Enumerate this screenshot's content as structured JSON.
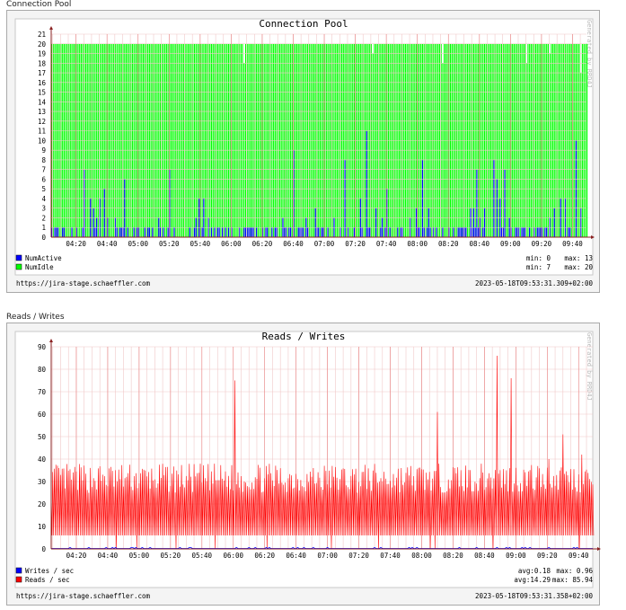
{
  "sections": [
    {
      "heading": "Connection Pool",
      "chart_data": {
        "type": "bar",
        "title": "Connection Pool",
        "watermark": "Generated by RRD4J",
        "ylim": [
          0,
          21
        ],
        "y_ticks": [
          0,
          1,
          2,
          3,
          4,
          5,
          6,
          7,
          8,
          9,
          10,
          11,
          12,
          13,
          14,
          15,
          16,
          17,
          18,
          19,
          20,
          21
        ],
        "x_ticks": [
          "04:20",
          "04:40",
          "05:00",
          "05:20",
          "05:40",
          "06:00",
          "06:20",
          "06:40",
          "07:00",
          "07:20",
          "07:40",
          "08:00",
          "08:20",
          "08:40",
          "09:00",
          "09:20",
          "09:40"
        ],
        "x_range": [
          "04:04",
          "09:49"
        ],
        "grid": true,
        "legend_position": "bottom-left",
        "series": [
          {
            "name": "NumActive",
            "color": "#0000ff",
            "min": "0",
            "max": "13",
            "min_label": "min:  0",
            "max_label": "max:  13",
            "spikes": [
              [
                "04:08",
                1
              ],
              [
                "04:11",
                1
              ],
              [
                "04:17",
                1
              ],
              [
                "04:25",
                7
              ],
              [
                "04:29",
                4
              ],
              [
                "04:31",
                3
              ],
              [
                "04:33",
                2
              ],
              [
                "04:35",
                4
              ],
              [
                "04:38",
                5
              ],
              [
                "04:40",
                2
              ],
              [
                "04:45",
                2
              ],
              [
                "04:51",
                6
              ],
              [
                "04:57",
                1
              ],
              [
                "05:07",
                1
              ],
              [
                "05:13",
                2
              ],
              [
                "05:20",
                7
              ],
              [
                "05:33",
                1
              ],
              [
                "05:37",
                2
              ],
              [
                "05:39",
                4
              ],
              [
                "05:42",
                4
              ],
              [
                "05:45",
                2
              ],
              [
                "05:58",
                1
              ],
              [
                "06:05",
                1
              ],
              [
                "06:11",
                1
              ],
              [
                "06:14",
                1
              ],
              [
                "06:22",
                1
              ],
              [
                "06:28",
                1
              ],
              [
                "06:33",
                2
              ],
              [
                "06:35",
                1
              ],
              [
                "06:37",
                1
              ],
              [
                "06:40",
                9
              ],
              [
                "06:44",
                1
              ],
              [
                "06:48",
                2
              ],
              [
                "06:54",
                3
              ],
              [
                "06:58",
                1
              ],
              [
                "07:06",
                2
              ],
              [
                "07:13",
                8
              ],
              [
                "07:19",
                1
              ],
              [
                "07:23",
                4
              ],
              [
                "07:27",
                11
              ],
              [
                "07:33",
                3
              ],
              [
                "07:37",
                2
              ],
              [
                "07:40",
                5
              ],
              [
                "07:42",
                1
              ],
              [
                "07:49",
                1
              ],
              [
                "07:55",
                2
              ],
              [
                "07:59",
                3
              ],
              [
                "08:03",
                8
              ],
              [
                "08:07",
                3
              ],
              [
                "08:10",
                1
              ],
              [
                "08:16",
                1
              ],
              [
                "08:23",
                1
              ],
              [
                "08:34",
                3
              ],
              [
                "08:36",
                3
              ],
              [
                "08:38",
                7
              ],
              [
                "08:40",
                2
              ],
              [
                "08:43",
                3
              ],
              [
                "08:49",
                8
              ],
              [
                "08:51",
                6
              ],
              [
                "08:53",
                4
              ],
              [
                "08:56",
                7
              ],
              [
                "08:59",
                2
              ],
              [
                "09:04",
                1
              ],
              [
                "09:12",
                1
              ],
              [
                "09:20",
                1
              ],
              [
                "09:25",
                2
              ],
              [
                "09:28",
                3
              ],
              [
                "09:32",
                4
              ],
              [
                "09:35",
                4
              ],
              [
                "09:38",
                1
              ],
              [
                "09:42",
                10
              ],
              [
                "09:45",
                3
              ]
            ]
          },
          {
            "name": "NumIdle",
            "color": "#00ff00",
            "min": "7",
            "max": "20",
            "min_label": "min:  7",
            "max_label": "max:  20",
            "dips": [
              [
                "06:08",
                18
              ],
              [
                "07:31",
                19
              ],
              [
                "08:16",
                18
              ],
              [
                "09:10",
                18
              ],
              [
                "09:25",
                19
              ],
              [
                "09:45",
                17
              ]
            ]
          }
        ],
        "footer_left": "https://jira-stage.schaeffler.com",
        "footer_right": "2023-05-18T09:53:31.309+02:00"
      }
    },
    {
      "heading": "Reads / Writes",
      "chart_data": {
        "type": "line",
        "title": "Reads / Writes",
        "watermark": "Generated by RRD4J",
        "ylim": [
          0,
          90
        ],
        "y_ticks": [
          0,
          10,
          20,
          30,
          40,
          50,
          60,
          70,
          80,
          90
        ],
        "x_ticks": [
          "04:20",
          "04:40",
          "05:00",
          "05:20",
          "05:40",
          "06:00",
          "06:20",
          "06:40",
          "07:00",
          "07:20",
          "07:40",
          "08:00",
          "08:20",
          "08:40",
          "09:00",
          "09:20",
          "09:40"
        ],
        "x_range": [
          "04:04",
          "09:49"
        ],
        "grid": true,
        "legend_position": "bottom-left",
        "series": [
          {
            "name": "Writes / sec",
            "color": "#0000ff",
            "avg": "0.18",
            "max": "0.96",
            "avg_label": "avg:0.18",
            "max_label": "max:  0.96",
            "baseline": 0.2
          },
          {
            "name": "Reads / sec",
            "color": "#ff0000",
            "avg": "14.29",
            "max": "85.94",
            "avg_label": "avg:14.29",
            "max_label": "max:  85.94",
            "low": 6,
            "high_range": [
              25,
              38
            ],
            "peaks": [
              [
                "06:01",
                75
              ],
              [
                "08:10",
                61
              ],
              [
                "08:48",
                86
              ],
              [
                "08:57",
                76
              ],
              [
                "09:30",
                51
              ],
              [
                "09:21",
                40
              ],
              [
                "09:42",
                42
              ]
            ],
            "zero_drops": [
              "04:45",
              "04:58",
              "05:23",
              "05:48",
              "06:21",
              "07:02",
              "07:32",
              "08:05",
              "08:08",
              "08:45",
              "09:40"
            ]
          }
        ],
        "footer_left": "https://jira-stage.schaeffler.com",
        "footer_right": "2023-05-18T09:53:31.358+02:00"
      }
    }
  ]
}
